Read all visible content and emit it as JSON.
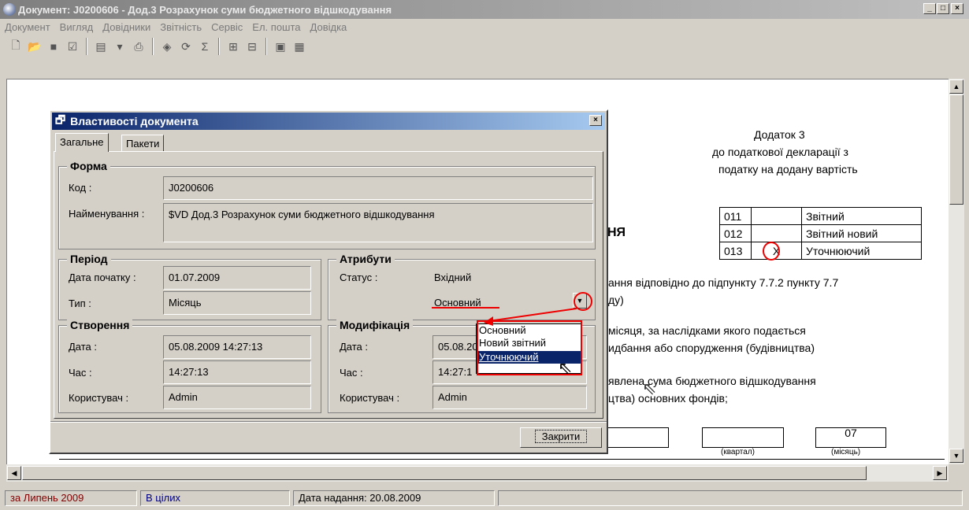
{
  "window": {
    "title": "Документ: J0200606 -  Дод.3 Розрахунок суми бюджетного відшкодування"
  },
  "menu": [
    "Документ",
    "Вигляд",
    "Довідники",
    "Звітність",
    "Сервіс",
    "Ел. пошта",
    "Довідка"
  ],
  "document": {
    "appendix_title": "Додаток 3",
    "appendix_line2": "до податкової декларації з",
    "appendix_line3": "податку на додану вартість",
    "heading_fragment": "НЯ",
    "status_table": [
      {
        "code": "011",
        "mark": "",
        "label": "Звітний"
      },
      {
        "code": "012",
        "mark": "",
        "label": "Звітний новий"
      },
      {
        "code": "013",
        "mark": "X",
        "label": "Уточнюючий"
      }
    ],
    "para1_line1": "ання відповідно до підпункту 7.7.2 пункту 7.7",
    "para1_line2": "ду)",
    "para2_line1": "місяця, за наслідками якого подається",
    "para2_line2": "идбання або спорудження (будівництва)",
    "para3_line1": "явлена сума бюджетного відшкодування",
    "para3_line2": "цтва) основних фондів;",
    "period_month_value": "07",
    "period_quarter_label": "(квартал)",
    "period_month_label": "(місяць)"
  },
  "dialog": {
    "title": "Властивості документа",
    "tabs": [
      "Загальне",
      "Пакети"
    ],
    "forma": {
      "title": "Форма",
      "code_label": "Код :",
      "code_value": "J0200606",
      "name_label": "Найменування :",
      "name_value": "$VD  Дод.3 Розрахунок суми бюджетного відшкодування"
    },
    "period": {
      "title": "Період",
      "start_label": "Дата початку :",
      "start_value": "01.07.2009",
      "type_label": "Тип :",
      "type_value": "Місяць"
    },
    "attributes": {
      "title": "Атрибути",
      "status_label": "Статус :",
      "status_value": "Вхідний",
      "kind_value": "Основний"
    },
    "dropdown_options": [
      "Основний",
      "Новий звітний",
      "Уточнюючий"
    ],
    "created": {
      "title": "Створення",
      "date_label": "Дата :",
      "date_value": "05.08.2009 14:27:13",
      "time_label": "Час :",
      "time_value": "14:27:13",
      "user_label": "Користувач :",
      "user_value": "Admin"
    },
    "modified": {
      "title": "Модифікація",
      "date_label": "Дата :",
      "date_value": "05.08.20",
      "time_label": "Час :",
      "time_value": "14:27:1",
      "user_label": "Користувач :",
      "user_value": "Admin"
    },
    "close_label": "Закрити"
  },
  "status": {
    "period": "за Липень 2009",
    "units": "В цілих",
    "submit_date": "Дата надання: 20.08.2009"
  },
  "colors": {
    "annotation": "#e00000",
    "selection": "#0a246a"
  }
}
